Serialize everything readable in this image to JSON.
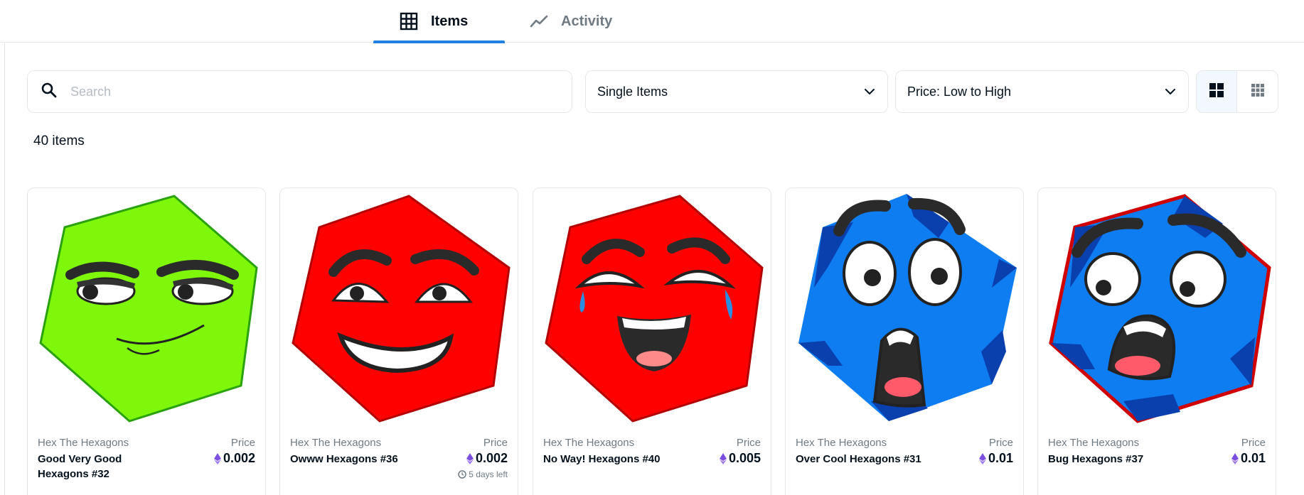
{
  "tabs": [
    {
      "label": "Items",
      "icon": "grid-table-icon",
      "active": true
    },
    {
      "label": "Activity",
      "icon": "activity-chart-icon",
      "active": false
    }
  ],
  "search": {
    "placeholder": "Search",
    "value": ""
  },
  "filters": {
    "type_select": {
      "value": "Single Items"
    },
    "sort_select": {
      "value": "Price: Low to High"
    }
  },
  "view_toggle": {
    "options": [
      "large-grid-icon",
      "small-grid-icon"
    ],
    "active": "large-grid-icon"
  },
  "results": {
    "count_label": "40 items"
  },
  "colors": {
    "accent": "#2081e2",
    "eth": "#7b4fe0",
    "green_hex": "#7ef70a",
    "red_hex": "#ff0000",
    "blue_hex": "#0e7df2"
  },
  "cards": [
    {
      "collection": "Hex The Hexagons",
      "name": "Good Very Good Hexagons #32",
      "price_label": "Price",
      "price": "0.002",
      "time_left": ""
    },
    {
      "collection": "Hex The Hexagons",
      "name": "Owww Hexagons #36",
      "price_label": "Price",
      "price": "0.002",
      "time_left": "5 days left"
    },
    {
      "collection": "Hex The Hexagons",
      "name": "No Way! Hexagons #40",
      "price_label": "Price",
      "price": "0.005",
      "time_left": ""
    },
    {
      "collection": "Hex The Hexagons",
      "name": "Over Cool Hexagons #31",
      "price_label": "Price",
      "price": "0.01",
      "time_left": ""
    },
    {
      "collection": "Hex The Hexagons",
      "name": "Bug Hexagons #37",
      "price_label": "Price",
      "price": "0.01",
      "time_left": ""
    }
  ]
}
